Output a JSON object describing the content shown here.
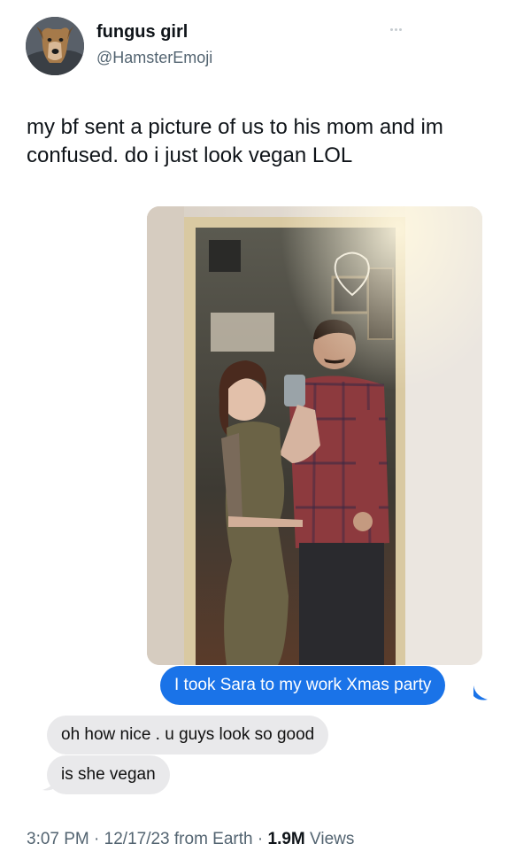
{
  "tweet": {
    "author": "fungus girl",
    "handle": "@HamsterEmoji",
    "text": "my bf sent a picture of us to his mom and im confused. do i just look vegan LOL",
    "avatar_icon": "dog-avatar",
    "more_icon": "more-options-icon"
  },
  "media": {
    "description_icon": "mirror-selfie-photo",
    "messages": [
      {
        "text": "I took Sara to my work Xmas party",
        "sender": "me",
        "color": "#1a73e8"
      },
      {
        "text": "oh how nice . u guys look so good",
        "sender": "other",
        "color": "#e9e9eb"
      },
      {
        "text": "is she vegan",
        "sender": "other",
        "color": "#e9e9eb"
      }
    ]
  },
  "meta": {
    "time": "3:07 PM",
    "date": "12/17/23",
    "source": "from Earth",
    "views_count": "1.9M",
    "views_label": "Views"
  }
}
